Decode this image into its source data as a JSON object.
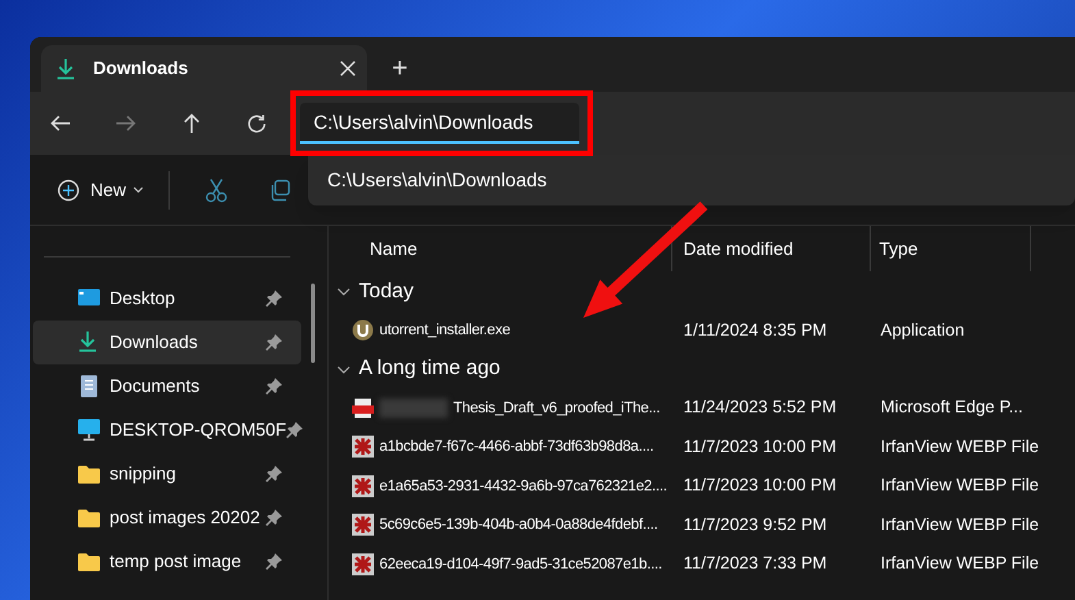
{
  "tab": {
    "title": "Downloads",
    "selected": true
  },
  "new_tab": "+",
  "address_bar": {
    "value": "C:\\Users\\alvin\\Downloads"
  },
  "suggestion": {
    "text": "C:\\Users\\alvin\\Downloads"
  },
  "toolbar": {
    "new_label": "New"
  },
  "sidebar": {
    "items": [
      {
        "label": "Desktop",
        "kind": "desktop",
        "selected": false
      },
      {
        "label": "Downloads",
        "kind": "download",
        "selected": true
      },
      {
        "label": "Documents",
        "kind": "document",
        "selected": false
      },
      {
        "label": "DESKTOP-QROM50F",
        "kind": "pc",
        "selected": false
      },
      {
        "label": "snipping",
        "kind": "folder",
        "selected": false
      },
      {
        "label": "post images 20202",
        "kind": "folder",
        "selected": false
      },
      {
        "label": "temp post image",
        "kind": "folder",
        "selected": false
      }
    ]
  },
  "columns": [
    "Name",
    "Date modified",
    "Type"
  ],
  "groups": [
    {
      "label": "Today",
      "expanded": true,
      "files": [
        {
          "name": "utorrent_installer.exe",
          "date": "1/11/2024 8:35 PM",
          "type": "Application",
          "kind": "exe",
          "redacted": false
        }
      ]
    },
    {
      "label": "A long time ago",
      "expanded": true,
      "files": [
        {
          "name": "Thesis_Draft_v6_proofed_iThe...",
          "date": "11/24/2023 5:52 PM",
          "type": "Microsoft Edge P...",
          "kind": "pdf",
          "redacted": true
        },
        {
          "name": "a1bcbde7-f67c-4466-abbf-73df63b98d8a....",
          "date": "11/7/2023 10:00 PM",
          "type": "IrfanView WEBP File",
          "kind": "image",
          "redacted": false
        },
        {
          "name": "e1a65a53-2931-4432-9a6b-97ca762321e2....",
          "date": "11/7/2023 10:00 PM",
          "type": "IrfanView WEBP File",
          "kind": "image",
          "redacted": false
        },
        {
          "name": "5c69c6e5-139b-404b-a0b4-0a88de4fdebf....",
          "date": "11/7/2023 9:52 PM",
          "type": "IrfanView WEBP File",
          "kind": "image",
          "redacted": false
        },
        {
          "name": "62eeca19-d104-49f7-9ad5-31ce52087e1b....",
          "date": "11/7/2023 7:33 PM",
          "type": "IrfanView WEBP File",
          "kind": "image",
          "redacted": false
        }
      ]
    }
  ]
}
